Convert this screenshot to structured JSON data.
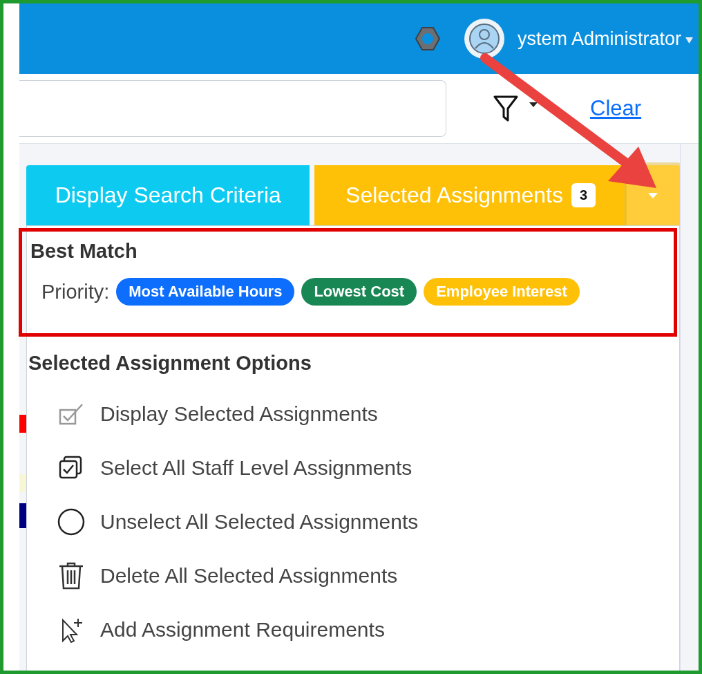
{
  "header": {
    "user": "ystem Administrator"
  },
  "toolbar": {
    "clear_link": "Clear"
  },
  "buttons": [
    {
      "label": "Display Search Criteria",
      "kind": "info"
    },
    {
      "label": "Selected Assignments",
      "kind": "warning",
      "badge": "3"
    }
  ],
  "dropdown": {
    "expanded": true,
    "best_match": {
      "title": "Best Match",
      "label": "Priority:",
      "tags": [
        {
          "text": "Most Available Hours",
          "color": "#0d6efd"
        },
        {
          "text": "Lowest Cost",
          "color": "#198754"
        },
        {
          "text": "Employee Interest",
          "color": "#ffc107"
        }
      ]
    },
    "options_title": "Selected Assignment Options",
    "options": [
      {
        "label": "Display Selected Assignments",
        "kind": "checklist"
      },
      {
        "label": "Select All Staff Level Assignments",
        "kind": "select-all"
      },
      {
        "label": "Unselect All Selected Assignments",
        "kind": "circle"
      },
      {
        "label": "Delete All Selected Assignments",
        "kind": "trash"
      },
      {
        "label": "Add Assignment Requirements",
        "kind": "pointer-add"
      }
    ]
  }
}
